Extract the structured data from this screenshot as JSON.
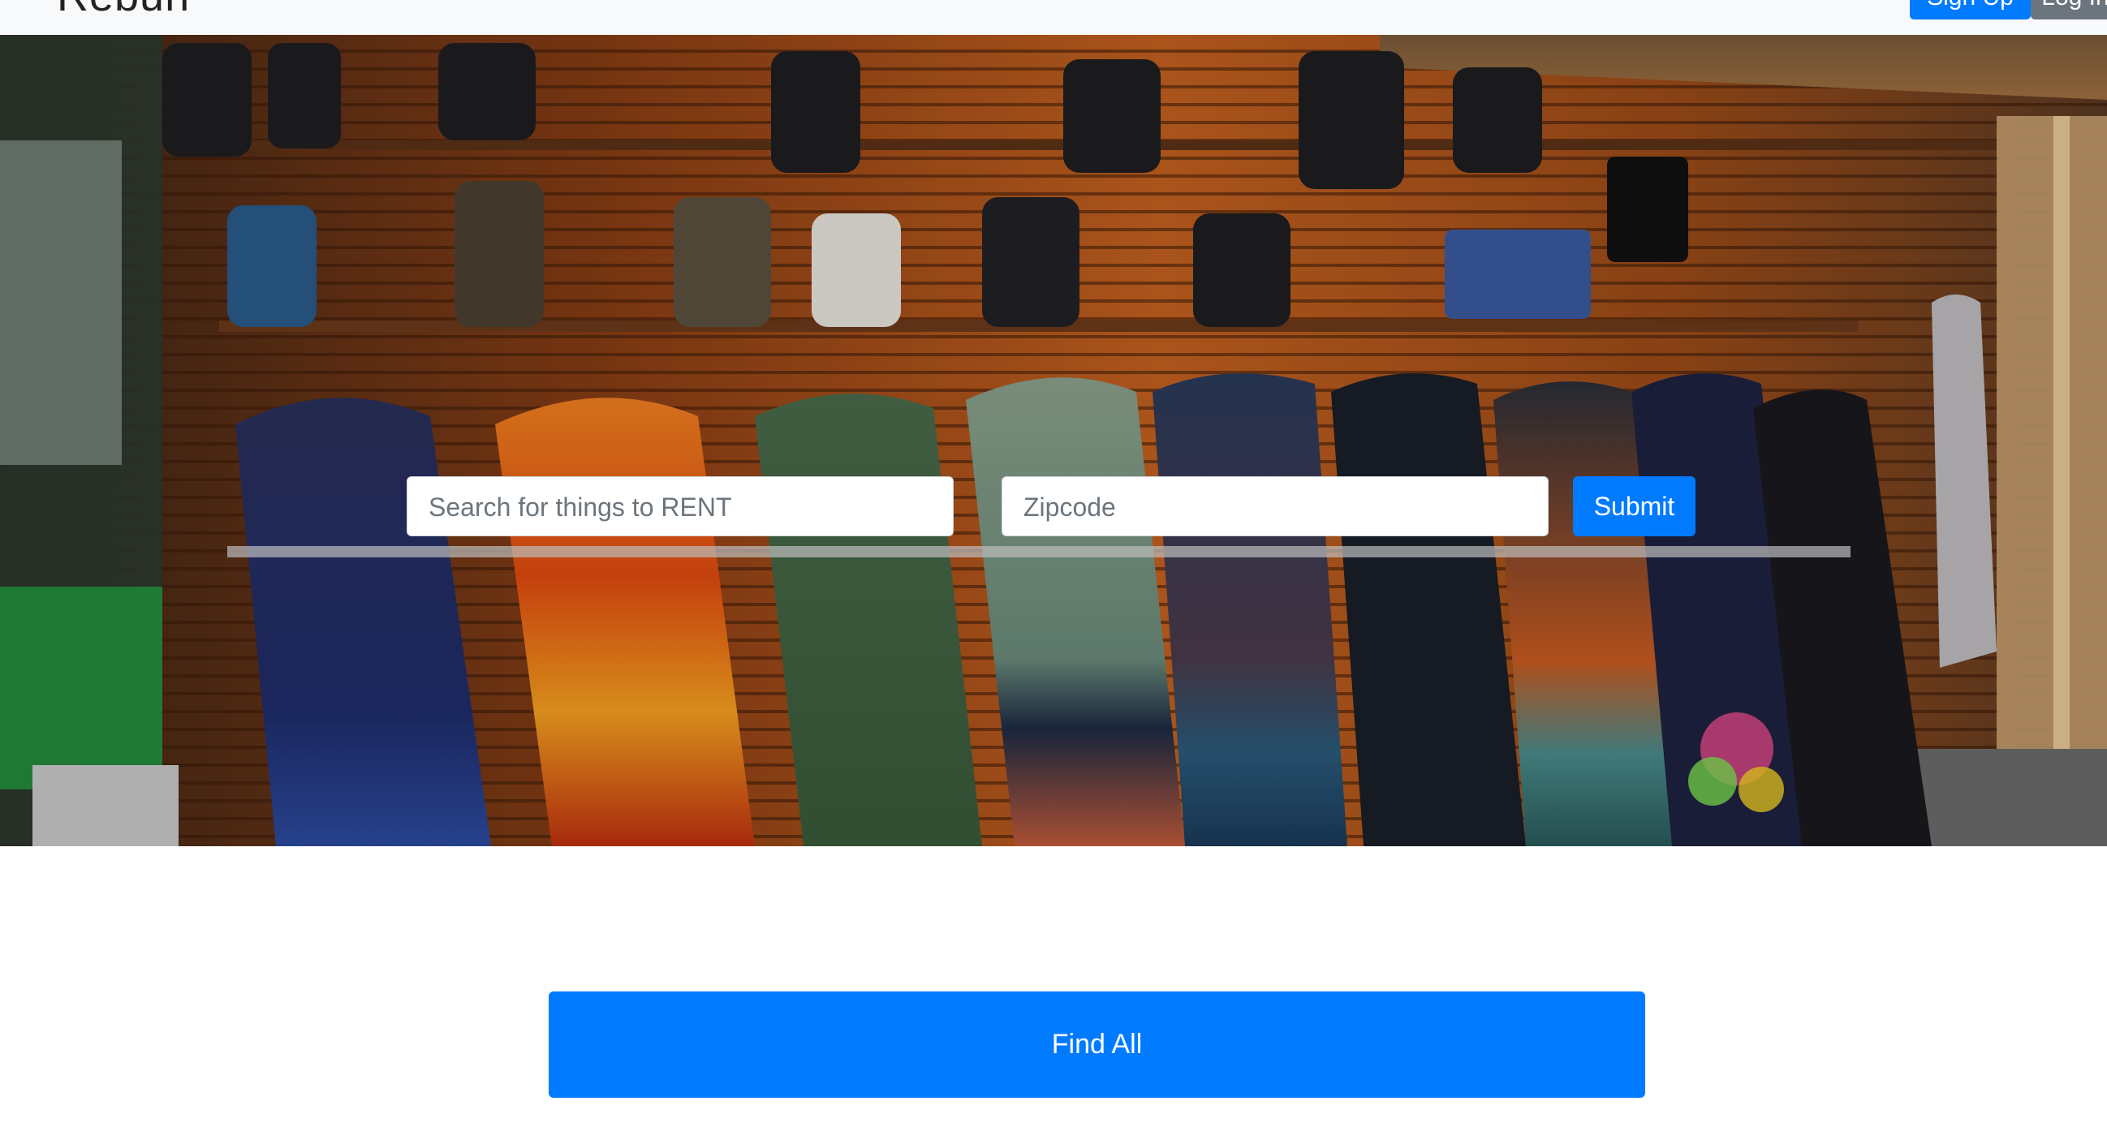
{
  "navbar": {
    "brand": "Rebun",
    "buttons": [
      {
        "label": "Sign Up"
      },
      {
        "label": "Log In"
      }
    ]
  },
  "hero": {
    "image_description": "snowboards and boots on a shop wall"
  },
  "search": {
    "query_placeholder": "Search for things to RENT",
    "zipcode_placeholder": "Zipcode",
    "submit_label": "Submit"
  },
  "actions": {
    "find_all_label": "Find All"
  },
  "colors": {
    "primary": "#007bff",
    "secondary": "#6c757d",
    "navbar_bg": "#f8f9fa"
  }
}
